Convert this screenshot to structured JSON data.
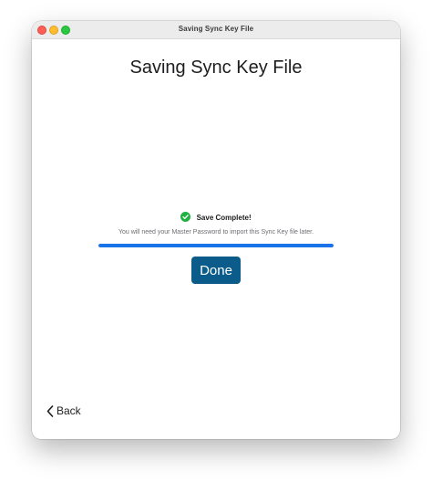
{
  "window": {
    "title": "Saving Sync Key File"
  },
  "main": {
    "heading": "Saving Sync Key File",
    "status": {
      "icon": "check-circle-icon",
      "text": "Save Complete!",
      "color": "#1fb141"
    },
    "hint": "You will need your Master Password to import this Sync Key file later.",
    "progress": {
      "percent": 100,
      "color": "#1a73e8"
    },
    "done_label": "Done",
    "accent": "#0b5c8a"
  },
  "footer": {
    "back_icon": "chevron-left-icon",
    "back_label": "Back"
  }
}
